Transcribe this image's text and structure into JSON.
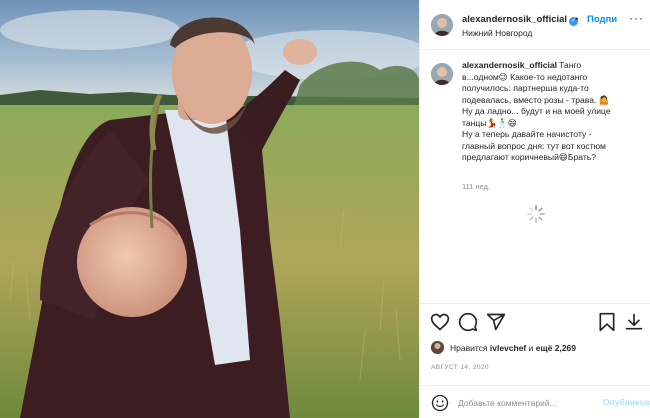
{
  "post": {
    "username": "alexandernosik_official",
    "verified_mark": "✓",
    "follow_separator": "•",
    "follow_label": "Подпи",
    "more_label": "···",
    "location": "Нижний Новгород"
  },
  "caption": {
    "username": "alexandernosik_official",
    "lines": [
      "Танго",
      "в...одном😉 Какое-то недотанго",
      "получилось: партнерша куда-то",
      "подевалась, вместо розы - трава. 🤷",
      "Ну да ладно... будут и на моей улице",
      "танцы💃🕺😄",
      "Ну а теперь давайте начистоту -",
      "главный вопрос дня: тут вот костюм",
      "предлагают коричневый😄Брать?"
    ],
    "time_ago": "111 нед."
  },
  "actions": {
    "icons": [
      "heart-icon",
      "comment-icon",
      "share-icon",
      "bookmark-icon",
      "download-icon"
    ]
  },
  "likes": {
    "prefix": "Нравится ",
    "liker": "ivlevchef",
    "middle": " и ",
    "count_text": "ещё 2,269"
  },
  "date": "АВГУСТ 14, 2020",
  "comment_box": {
    "placeholder": "Добавьте комментарий...",
    "publish_label": "Опубликовать"
  },
  "colors": {
    "accent": "#0095f6",
    "verified": "#3897f0",
    "publish_disabled": "#b2dffc",
    "secondary_text": "#8e8e8e"
  }
}
